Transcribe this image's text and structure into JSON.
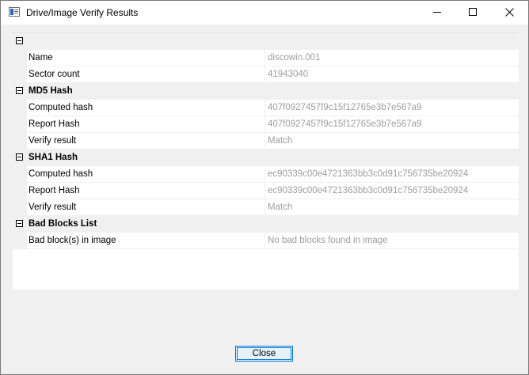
{
  "window": {
    "title": "Drive/Image Verify Results",
    "icon": "window-app-icon"
  },
  "grid": {
    "sections": [
      {
        "title": "",
        "rows": [
          {
            "name": "Name",
            "value": "discowin.001"
          },
          {
            "name": "Sector count",
            "value": "41943040"
          }
        ]
      },
      {
        "title": "MD5 Hash",
        "rows": [
          {
            "name": "Computed hash",
            "value": "407f0927457f9c15f12765e3b7e567a9"
          },
          {
            "name": "Report Hash",
            "value": "407f0927457f9c15f12765e3b7e567a9"
          },
          {
            "name": "Verify result",
            "value": "Match"
          }
        ]
      },
      {
        "title": "SHA1 Hash",
        "rows": [
          {
            "name": "Computed hash",
            "value": "ec90339c00e4721363bb3c0d91c756735be20924"
          },
          {
            "name": "Report Hash",
            "value": "ec90339c00e4721363bb3c0d91c756735be20924"
          },
          {
            "name": "Verify result",
            "value": "Match"
          }
        ]
      },
      {
        "title": "Bad Blocks List",
        "rows": [
          {
            "name": "Bad block(s) in image",
            "value": "No bad blocks found in image"
          }
        ]
      }
    ]
  },
  "buttons": {
    "close_label": "Close"
  }
}
